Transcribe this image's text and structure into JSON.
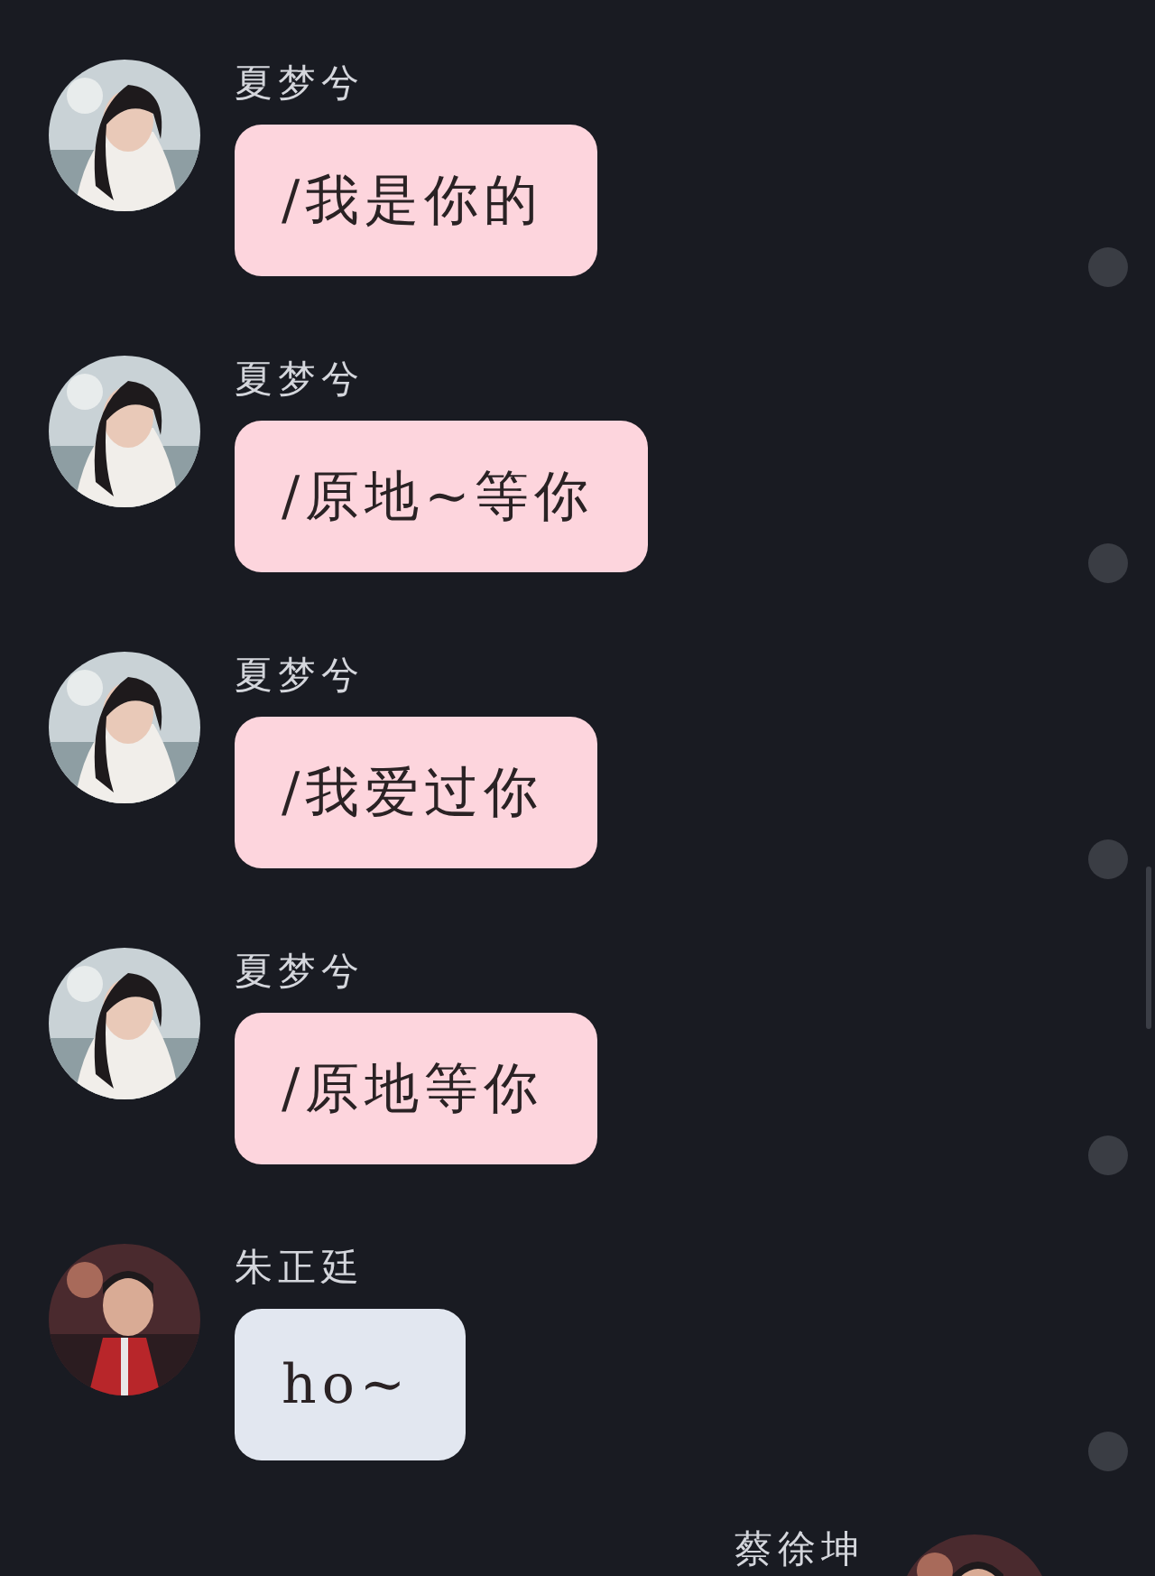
{
  "messages": [
    {
      "kind": "incoming",
      "name": "夏梦兮",
      "text": "/我是你的",
      "color": "#fdd5dd"
    },
    {
      "kind": "incoming",
      "name": "夏梦兮",
      "text": "/原地~等你",
      "color": "#fdd5dd"
    },
    {
      "kind": "incoming",
      "name": "夏梦兮",
      "text": "/我爱过你",
      "color": "#fdd5dd"
    },
    {
      "kind": "incoming",
      "name": "夏梦兮",
      "text": "/原地等你",
      "color": "#fdd5dd"
    },
    {
      "kind": "incoming",
      "name": "朱正廷",
      "text": "ho~",
      "color": "#e2e7f0"
    },
    {
      "kind": "outgoing",
      "name": "蔡徐坤"
    }
  ]
}
